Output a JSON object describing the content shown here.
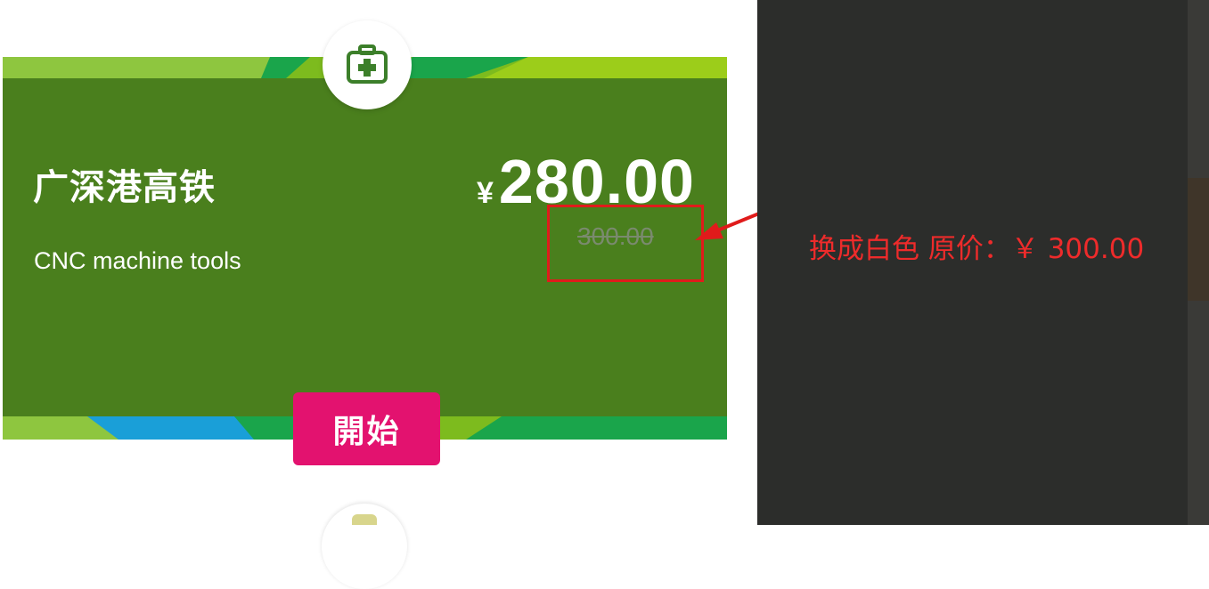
{
  "card": {
    "title": "广深港高铁",
    "subtitle": "CNC machine tools",
    "price_symbol": "¥",
    "price": "280.00",
    "original_price": "300.00",
    "start_label": "開始",
    "badge_icon": "medkit-icon"
  },
  "annotation": {
    "note": "换成白色 原价：￥ 300.00",
    "color": "#e01b1b"
  },
  "colors": {
    "card_green": "#4a7f1d",
    "start_button": "#e3126f",
    "dark_panel": "#2c2d2b"
  }
}
